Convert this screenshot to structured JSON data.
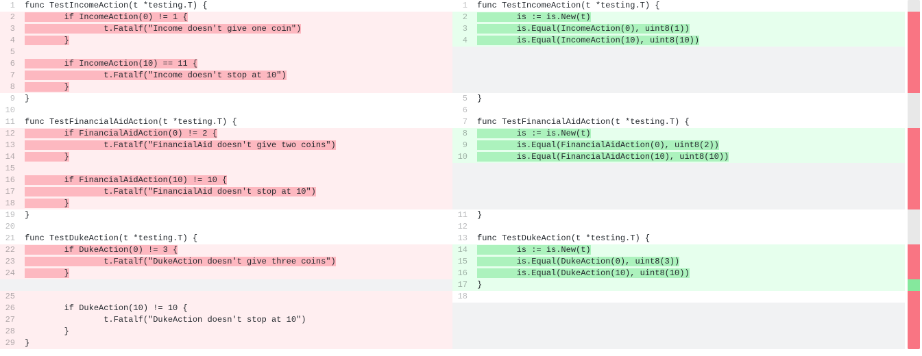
{
  "left": {
    "rows": [
      {
        "n": 1,
        "cls": "ctx",
        "text": "func TestIncomeAction(t *testing.T) {"
      },
      {
        "n": 2,
        "cls": "del-hard",
        "text": "        if IncomeAction(0) != 1 {"
      },
      {
        "n": 3,
        "cls": "del-hard",
        "text": "                t.Fatalf(\"Income doesn't give one coin\")"
      },
      {
        "n": 4,
        "cls": "del-hard",
        "text": "        }"
      },
      {
        "n": 5,
        "cls": "del-soft",
        "text": ""
      },
      {
        "n": 6,
        "cls": "del-hard",
        "text": "        if IncomeAction(10) == 11 {"
      },
      {
        "n": 7,
        "cls": "del-hard",
        "text": "                t.Fatalf(\"Income doesn't stop at 10\")"
      },
      {
        "n": 8,
        "cls": "del-hard",
        "text": "        }"
      },
      {
        "n": 9,
        "cls": "ctx",
        "text": "}"
      },
      {
        "n": 10,
        "cls": "ctx",
        "text": ""
      },
      {
        "n": 11,
        "cls": "ctx",
        "text": "func TestFinancialAidAction(t *testing.T) {"
      },
      {
        "n": 12,
        "cls": "del-hard",
        "text": "        if FinancialAidAction(0) != 2 {"
      },
      {
        "n": 13,
        "cls": "del-hard",
        "text": "                t.Fatalf(\"FinancialAid doesn't give two coins\")"
      },
      {
        "n": 14,
        "cls": "del-hard",
        "text": "        }"
      },
      {
        "n": 15,
        "cls": "del-soft",
        "text": ""
      },
      {
        "n": 16,
        "cls": "del-hard",
        "text": "        if FinancialAidAction(10) != 10 {"
      },
      {
        "n": 17,
        "cls": "del-hard",
        "text": "                t.Fatalf(\"FinancialAid doesn't stop at 10\")"
      },
      {
        "n": 18,
        "cls": "del-hard",
        "text": "        }"
      },
      {
        "n": 19,
        "cls": "ctx",
        "text": "}"
      },
      {
        "n": 20,
        "cls": "ctx",
        "text": ""
      },
      {
        "n": 21,
        "cls": "ctx",
        "text": "func TestDukeAction(t *testing.T) {"
      },
      {
        "n": 22,
        "cls": "del-hard",
        "text": "        if DukeAction(0) != 3 {"
      },
      {
        "n": 23,
        "cls": "del-hard",
        "text": "                t.Fatalf(\"DukeAction doesn't give three coins\")"
      },
      {
        "n": 24,
        "cls": "del-hard",
        "text": "        }"
      },
      {
        "n": null,
        "cls": "empty",
        "text": ""
      },
      {
        "n": 25,
        "cls": "del-soft",
        "text": ""
      },
      {
        "n": 26,
        "cls": "del-soft",
        "text": "        if DukeAction(10) != 10 {"
      },
      {
        "n": 27,
        "cls": "del-soft",
        "text": "                t.Fatalf(\"DukeAction doesn't stop at 10\")"
      },
      {
        "n": 28,
        "cls": "del-soft",
        "text": "        }"
      },
      {
        "n": 29,
        "cls": "del-soft",
        "text": "}"
      }
    ]
  },
  "right": {
    "rows": [
      {
        "n": 1,
        "cls": "ctx",
        "text": "func TestIncomeAction(t *testing.T) {"
      },
      {
        "n": 2,
        "cls": "add-hard",
        "text": "        is := is.New(t)"
      },
      {
        "n": 3,
        "cls": "add-hard",
        "text": "        is.Equal(IncomeAction(0), uint8(1))"
      },
      {
        "n": 4,
        "cls": "add-hard",
        "text": "        is.Equal(IncomeAction(10), uint8(10))"
      },
      {
        "n": null,
        "cls": "empty",
        "text": ""
      },
      {
        "n": null,
        "cls": "empty",
        "text": ""
      },
      {
        "n": null,
        "cls": "empty",
        "text": ""
      },
      {
        "n": null,
        "cls": "empty",
        "text": ""
      },
      {
        "n": 5,
        "cls": "ctx",
        "text": "}"
      },
      {
        "n": 6,
        "cls": "ctx",
        "text": ""
      },
      {
        "n": 7,
        "cls": "ctx",
        "text": "func TestFinancialAidAction(t *testing.T) {"
      },
      {
        "n": 8,
        "cls": "add-hard",
        "text": "        is := is.New(t)"
      },
      {
        "n": 9,
        "cls": "add-hard",
        "text": "        is.Equal(FinancialAidAction(0), uint8(2))"
      },
      {
        "n": 10,
        "cls": "add-hard",
        "text": "        is.Equal(FinancialAidAction(10), uint8(10))"
      },
      {
        "n": null,
        "cls": "empty",
        "text": ""
      },
      {
        "n": null,
        "cls": "empty",
        "text": ""
      },
      {
        "n": null,
        "cls": "empty",
        "text": ""
      },
      {
        "n": null,
        "cls": "empty",
        "text": ""
      },
      {
        "n": 11,
        "cls": "ctx",
        "text": "}"
      },
      {
        "n": 12,
        "cls": "ctx",
        "text": ""
      },
      {
        "n": 13,
        "cls": "ctx",
        "text": "func TestDukeAction(t *testing.T) {"
      },
      {
        "n": 14,
        "cls": "add-hard",
        "text": "        is := is.New(t)"
      },
      {
        "n": 15,
        "cls": "add-hard",
        "text": "        is.Equal(DukeAction(0), uint8(3))"
      },
      {
        "n": 16,
        "cls": "add-hard",
        "text": "        is.Equal(DukeAction(10), uint8(10))"
      },
      {
        "n": 17,
        "cls": "add-soft",
        "text": "}"
      },
      {
        "n": 18,
        "cls": "ctx",
        "text": ""
      },
      {
        "n": null,
        "cls": "empty",
        "text": ""
      },
      {
        "n": null,
        "cls": "empty",
        "text": ""
      },
      {
        "n": null,
        "cls": "empty",
        "text": ""
      },
      {
        "n": null,
        "cls": "empty",
        "text": ""
      }
    ]
  },
  "minimap": [
    "n",
    "d",
    "d",
    "d",
    "d",
    "d",
    "d",
    "d",
    "n",
    "n",
    "n",
    "d",
    "d",
    "d",
    "d",
    "d",
    "d",
    "d",
    "n",
    "n",
    "n",
    "d",
    "d",
    "d",
    "n",
    "d",
    "d",
    "d",
    "d",
    "d"
  ],
  "minimap_right": [
    "n",
    "a",
    "a",
    "a",
    "n",
    "n",
    "n",
    "n",
    "n",
    "n",
    "n",
    "a",
    "a",
    "a",
    "n",
    "n",
    "n",
    "n",
    "n",
    "n",
    "n",
    "a",
    "a",
    "a",
    "a",
    "n",
    "n",
    "n",
    "n",
    "n"
  ]
}
